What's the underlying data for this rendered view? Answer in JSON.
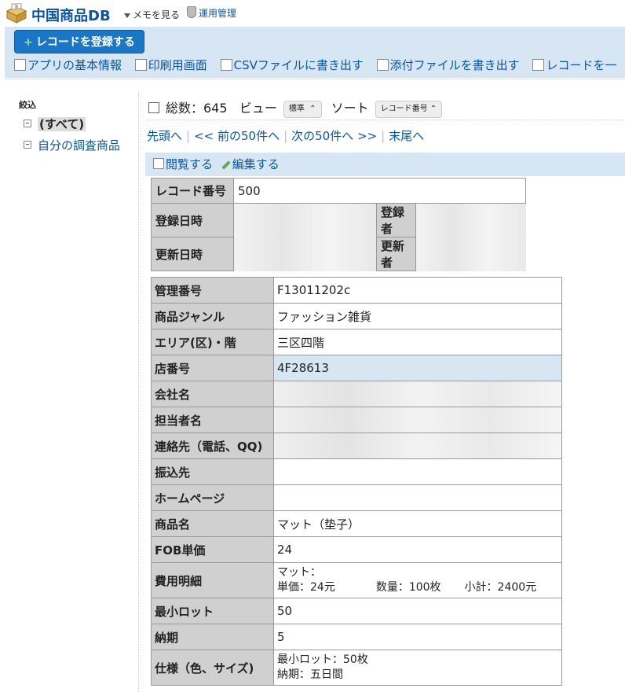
{
  "app": {
    "title": "中国商品DB",
    "memo": "メモを見る",
    "ops": "運用管理"
  },
  "toolbar": {
    "register": "レコードを登録する",
    "links": [
      "アプリの基本情報",
      "印刷用画面",
      "CSVファイルに書き出す",
      "添付ファイルを書き出す",
      "レコードを一"
    ]
  },
  "filter": {
    "head": "絞込",
    "items": [
      "(すべて)",
      "自分の調査商品"
    ]
  },
  "summary": {
    "total_label": "総数：645",
    "view_label": "ビュー",
    "view_value": "標準",
    "sort_label": "ソート",
    "sort_value": "レコード番号"
  },
  "pager": {
    "first": "先頭へ",
    "prev": "<< 前の50件へ",
    "next": "次の50件へ >>",
    "last": "末尾へ"
  },
  "record_actions": {
    "view": "閲覧する",
    "edit": "編集する"
  },
  "meta": {
    "record_no_label": "レコード番号",
    "record_no": "500",
    "created_at_label": "登録日時",
    "created_by_label": "登録者",
    "updated_at_label": "更新日時",
    "updated_by_label": "更新者"
  },
  "fields": [
    {
      "label": "管理番号",
      "value": "F13011202c"
    },
    {
      "label": "商品ジャンル",
      "value": "ファッション雑貨"
    },
    {
      "label": "エリア(区)・階",
      "value": "三区四階"
    },
    {
      "label": "店番号",
      "value": "4F28613"
    },
    {
      "label": "会社名",
      "value": ""
    },
    {
      "label": "担当者名",
      "value": ""
    },
    {
      "label": "連絡先（電話、QQ)",
      "value": ""
    },
    {
      "label": "振込先",
      "value": ""
    },
    {
      "label": "ホームページ",
      "value": ""
    },
    {
      "label": "商品名",
      "value": "マット（垫子）"
    },
    {
      "label": "FOB単価",
      "value": "24"
    },
    {
      "label": "費用明細",
      "line1": "マット：",
      "unit": "単価：24元",
      "qty": "数量：100枚",
      "sub": "小計：2400元"
    },
    {
      "label": "最小ロット",
      "value": "50"
    },
    {
      "label": "納期",
      "value": "5"
    },
    {
      "label": "仕様（色、サイズ)",
      "line1": "最小ロット：50枚",
      "line2": "納期：五日間"
    }
  ]
}
